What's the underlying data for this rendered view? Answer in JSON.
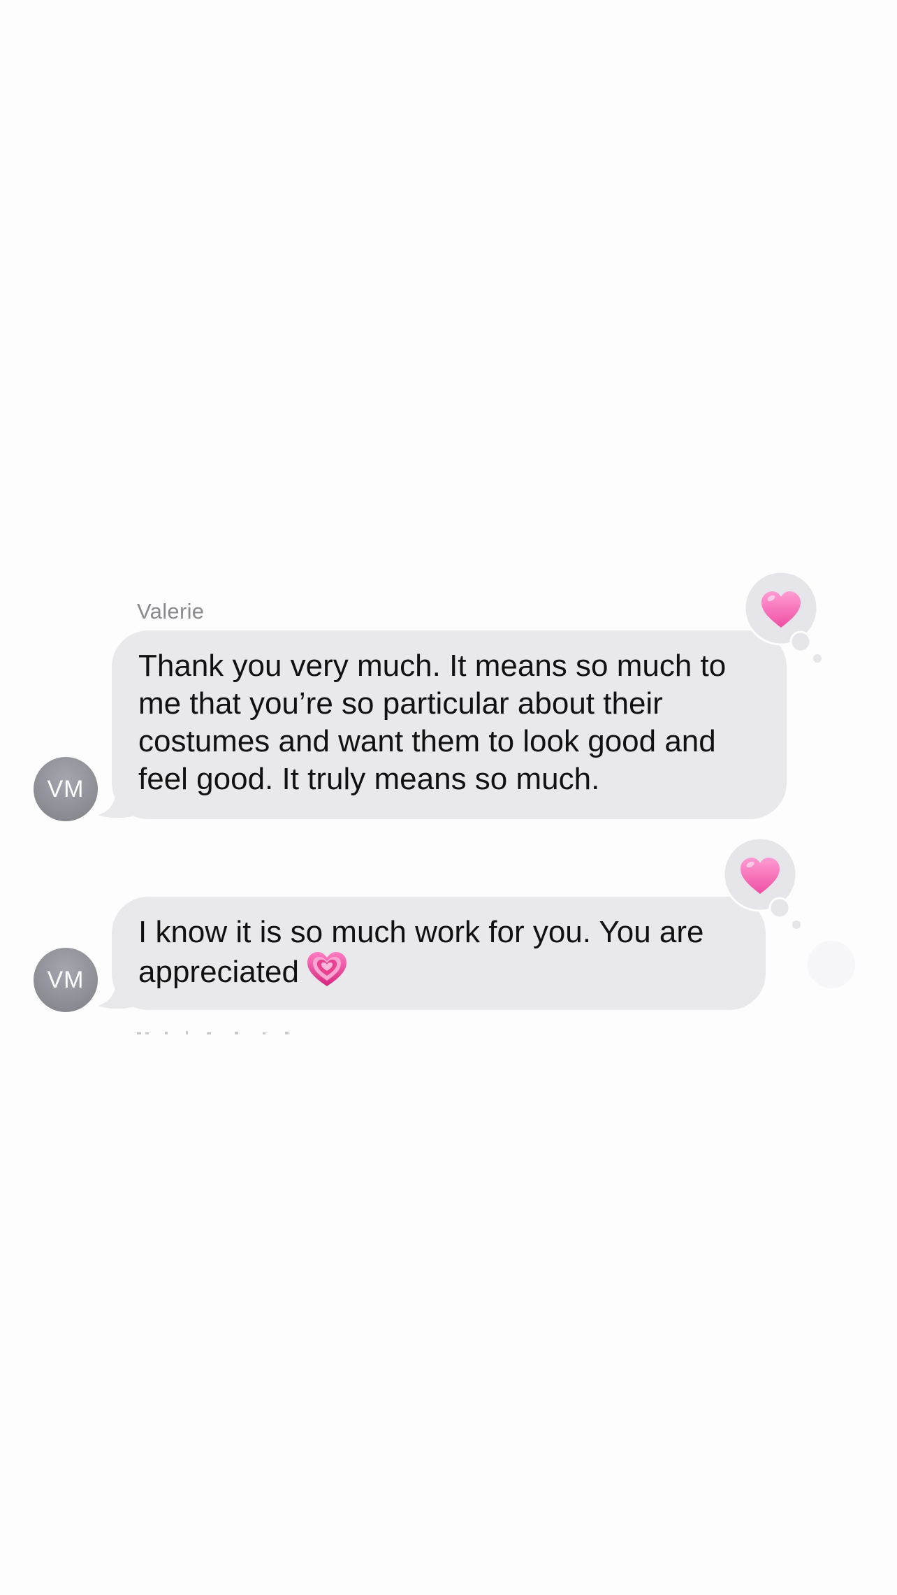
{
  "conversation": {
    "sender_name": "Valerie",
    "messages": [
      {
        "text": "Thank you very much. It means so much to\nme that you’re so particular about their\ncostumes and want them to look good and\nfeel good. It truly means so much.",
        "avatar_initials": "VM",
        "tapback": "heart-icon"
      },
      {
        "text": "I know it is so much work for you. You are\nappreciated",
        "emoji": "growing-heart-emoji",
        "avatar_initials": "VM",
        "tapback": "heart-icon"
      }
    ]
  },
  "colors": {
    "bubble": "#e9e9eb",
    "avatar": "#8a8b93",
    "heart": "#f26bb4",
    "background": "#fdfdfd"
  }
}
